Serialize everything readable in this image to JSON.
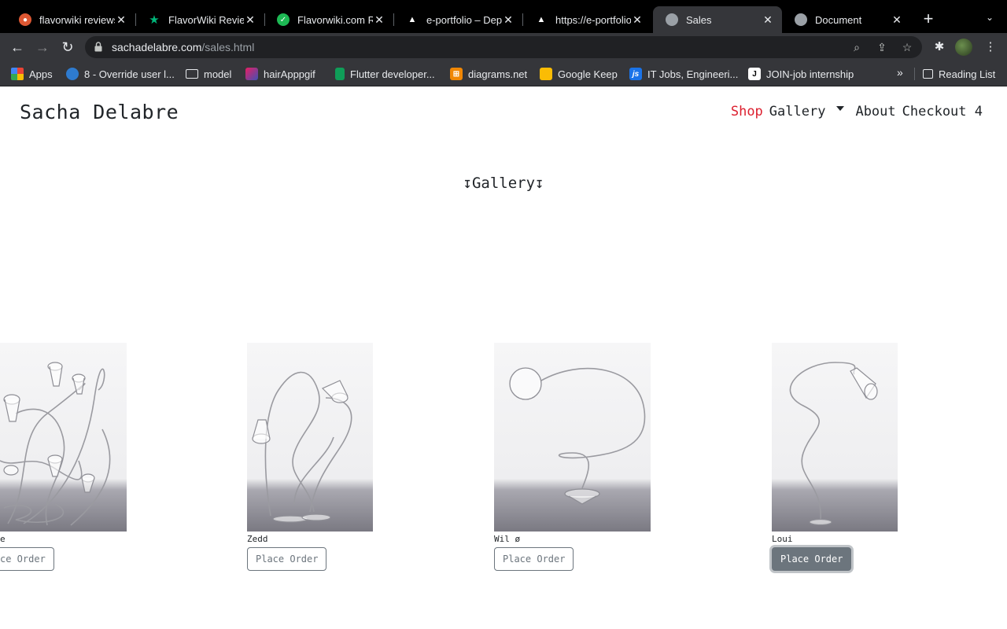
{
  "browser": {
    "tabs": [
      {
        "title": "flavorwiki reviews",
        "favicon": "duckduckgo-icon",
        "color": "#de5833",
        "active": false
      },
      {
        "title": "FlavorWiki Reviews",
        "favicon": "trustpilot-star-icon",
        "color": "#00b67a",
        "active": false
      },
      {
        "title": "Flavorwiki.com Re",
        "favicon": "check-circle-icon",
        "color": "#1db954",
        "active": false
      },
      {
        "title": "e-portfolio – Depl",
        "favicon": "vercel-triangle-icon",
        "color": "#ffffff",
        "active": false
      },
      {
        "title": "https://e-portfolio",
        "favicon": "vercel-triangle-icon",
        "color": "#ffffff",
        "active": false
      },
      {
        "title": "Sales",
        "favicon": "globe-icon",
        "color": "#9aa0a6",
        "active": true
      },
      {
        "title": "Document",
        "favicon": "globe-icon",
        "color": "#9aa0a6",
        "active": false
      }
    ],
    "url_host": "sachadelabre.com",
    "url_path": "/sales.html",
    "bookmarks": [
      {
        "label": "Apps",
        "icon": "apps-grid-icon"
      },
      {
        "label": "8 - Override user l...",
        "icon": "drop-icon"
      },
      {
        "label": "model",
        "icon": "folder-icon"
      },
      {
        "label": "hairApppgif",
        "icon": "page-icon"
      },
      {
        "label": "Flutter developer...",
        "icon": "sheet-icon"
      },
      {
        "label": "diagrams.net",
        "icon": "diagrams-icon"
      },
      {
        "label": "Google Keep",
        "icon": "keep-icon"
      },
      {
        "label": "IT Jobs, Engineeri...",
        "icon": "js-icon"
      },
      {
        "label": "JOIN-job internship",
        "icon": "join-icon"
      }
    ],
    "bookmarks_more": "»",
    "reading_list": "Reading List"
  },
  "site": {
    "brand": "Sacha Delabre",
    "nav": {
      "shop": "Shop",
      "gallery": "Gallery",
      "about": "About",
      "checkout": "Checkout 4"
    },
    "gallery_title": "↧Gallery↧",
    "products": [
      {
        "name": "e",
        "button": "ce Order"
      },
      {
        "name": "Zedd",
        "button": "Place Order"
      },
      {
        "name": "Wil ø",
        "button": "Place Order"
      },
      {
        "name": "Loui",
        "button": "Place Order"
      }
    ],
    "accent_color": "#dc1f2e",
    "button_color": "#6c757d"
  }
}
